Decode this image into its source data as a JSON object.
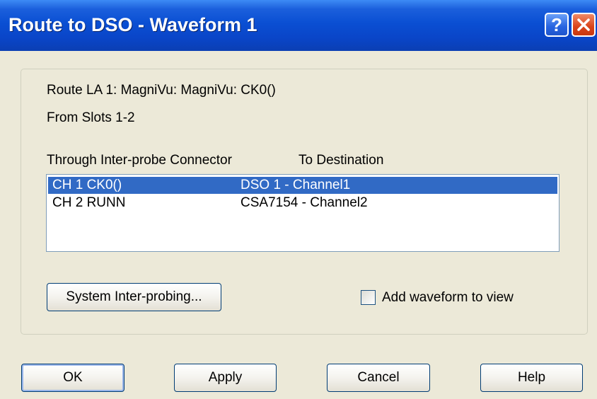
{
  "window": {
    "title": "Route to DSO - Waveform 1",
    "help_glyph": "?",
    "close_icon": "close-x-icon"
  },
  "info": {
    "route_line": "Route LA 1: MagniVu: MagniVu: CK0()",
    "slots_line": "From Slots 1-2"
  },
  "list": {
    "headers": [
      "Through Inter-probe Connector",
      "To Destination"
    ],
    "rows": [
      {
        "connector": "CH 1 CK0()",
        "destination": "DSO 1 - Channel1",
        "selected": true
      },
      {
        "connector": "CH 2 RUNN",
        "destination": "CSA7154 - Channel2",
        "selected": false
      }
    ]
  },
  "controls": {
    "system_button": "System Inter-probing...",
    "add_waveform_label": "Add waveform to view",
    "add_waveform_checked": false
  },
  "buttons": {
    "ok": "OK",
    "apply": "Apply",
    "cancel": "Cancel",
    "help": "Help"
  },
  "colors": {
    "titlebar": "#0a4fd3",
    "selection": "#316ac5",
    "face": "#ece9d8",
    "close": "#d9431a"
  }
}
